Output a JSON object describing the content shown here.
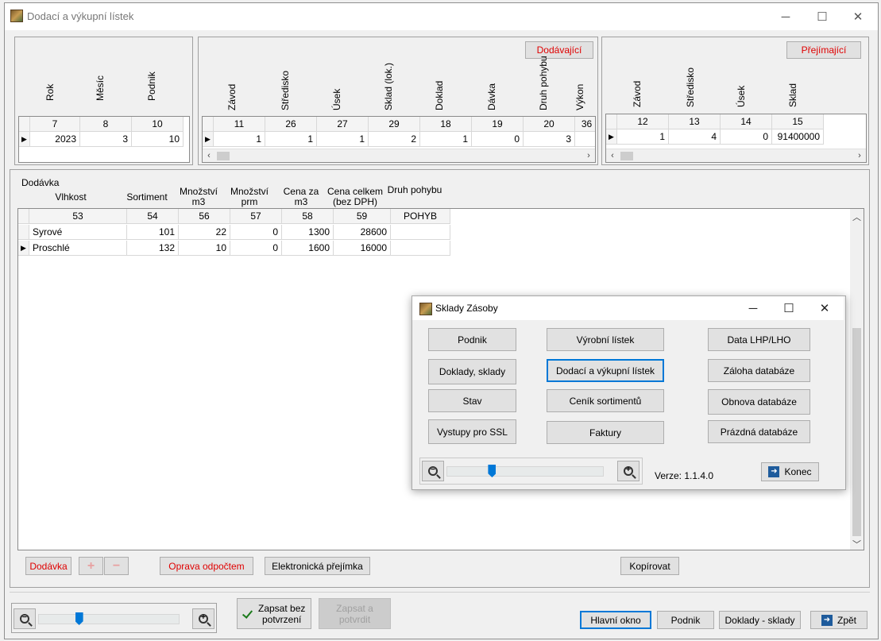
{
  "window": {
    "title": "Dodací a výkupní lístek"
  },
  "window_controls": {
    "minimize": "─",
    "maximize": "☐",
    "close": "✕"
  },
  "top_left": {
    "headers": [
      "Rok",
      "Měsíc",
      "Podnik"
    ],
    "columns": [
      "7",
      "8",
      "10"
    ],
    "row": [
      "2023",
      "3",
      "10"
    ]
  },
  "top_mid": {
    "button": "Dodávající",
    "headers": [
      "Závod",
      "Středisko",
      "Úsek",
      "Sklad (lok.)",
      "Doklad",
      "Dávka",
      "Druh pohybu",
      "Výkon"
    ],
    "columns": [
      "11",
      "26",
      "27",
      "29",
      "18",
      "19",
      "20",
      "36"
    ],
    "row": [
      "1",
      "1",
      "1",
      "2",
      "1",
      "0",
      "3",
      ""
    ]
  },
  "top_right": {
    "button": "Přejímající",
    "headers": [
      "Závod",
      "Středisko",
      "Úsek",
      "Sklad"
    ],
    "columns": [
      "12",
      "13",
      "14",
      "15"
    ],
    "row": [
      "1",
      "4",
      "0",
      "91400000"
    ]
  },
  "dodavka": {
    "title": "Dodávka",
    "headers": {
      "vlhkost": "Vlhkost",
      "sortiment": "Sortiment",
      "mnozstvi_m3_a": "Množství",
      "mnozstvi_m3_b": "m3",
      "mnozstvi_prm_a": "Množství",
      "mnozstvi_prm_b": "prm",
      "cena_a": "Cena za",
      "cena_b": "m3",
      "cena_celkem_a": "Cena celkem",
      "cena_celkem_b": "(bez DPH)",
      "druh": "Druh pohybu"
    },
    "columns": [
      "53",
      "54",
      "56",
      "57",
      "58",
      "59",
      "POHYB"
    ],
    "rows": [
      [
        "Syrové",
        "101",
        "22",
        "0",
        "1300",
        "28600",
        ""
      ],
      [
        "Proschlé",
        "132",
        "10",
        "0",
        "1600",
        "16000",
        ""
      ]
    ]
  },
  "actions": {
    "dodavka": "Dodávka",
    "add": "+",
    "remove": "−",
    "oprava": "Oprava odpočtem",
    "elektronicka": "Elektronická přejímka",
    "kopirovat": "Kopírovat"
  },
  "footer": {
    "zapsat_bez_1": "Zapsat bez",
    "zapsat_bez_2": "potvrzení",
    "zapsat_a_1": "Zapsat a",
    "zapsat_a_2": "potvrdit",
    "hlavni_okno": "Hlavní okno",
    "podnik": "Podnik",
    "doklady_sklady": "Doklady - sklady",
    "zpet": "Zpět",
    "zoom_level": 0.29
  },
  "dialog": {
    "title": "Sklady Zásoby",
    "buttons": {
      "podnik": "Podnik",
      "vyrobni": "Výrobní lístek",
      "data_lhp": "Data LHP/LHO",
      "doklady": "Doklady, sklady",
      "dodaci": "Dodací a výkupní lístek",
      "zaloha": "Záloha databáze",
      "stav": "Stav",
      "cenik": "Ceník sortimentů",
      "obnova": "Obnova databáze",
      "vystupy": "Vystupy pro SSL",
      "faktury": "Faktury",
      "prazdna": "Prázdná databáze",
      "konec": "Konec"
    },
    "verze": "Verze: 1.1.4.0",
    "zoom_level": 0.29
  },
  "colors": {
    "accent": "#0078d7",
    "red_text": "#e00000"
  },
  "icons": [
    "app-icon",
    "zoom-out-icon",
    "zoom-in-icon",
    "checkmark-icon",
    "exit-arrow-icon"
  ]
}
